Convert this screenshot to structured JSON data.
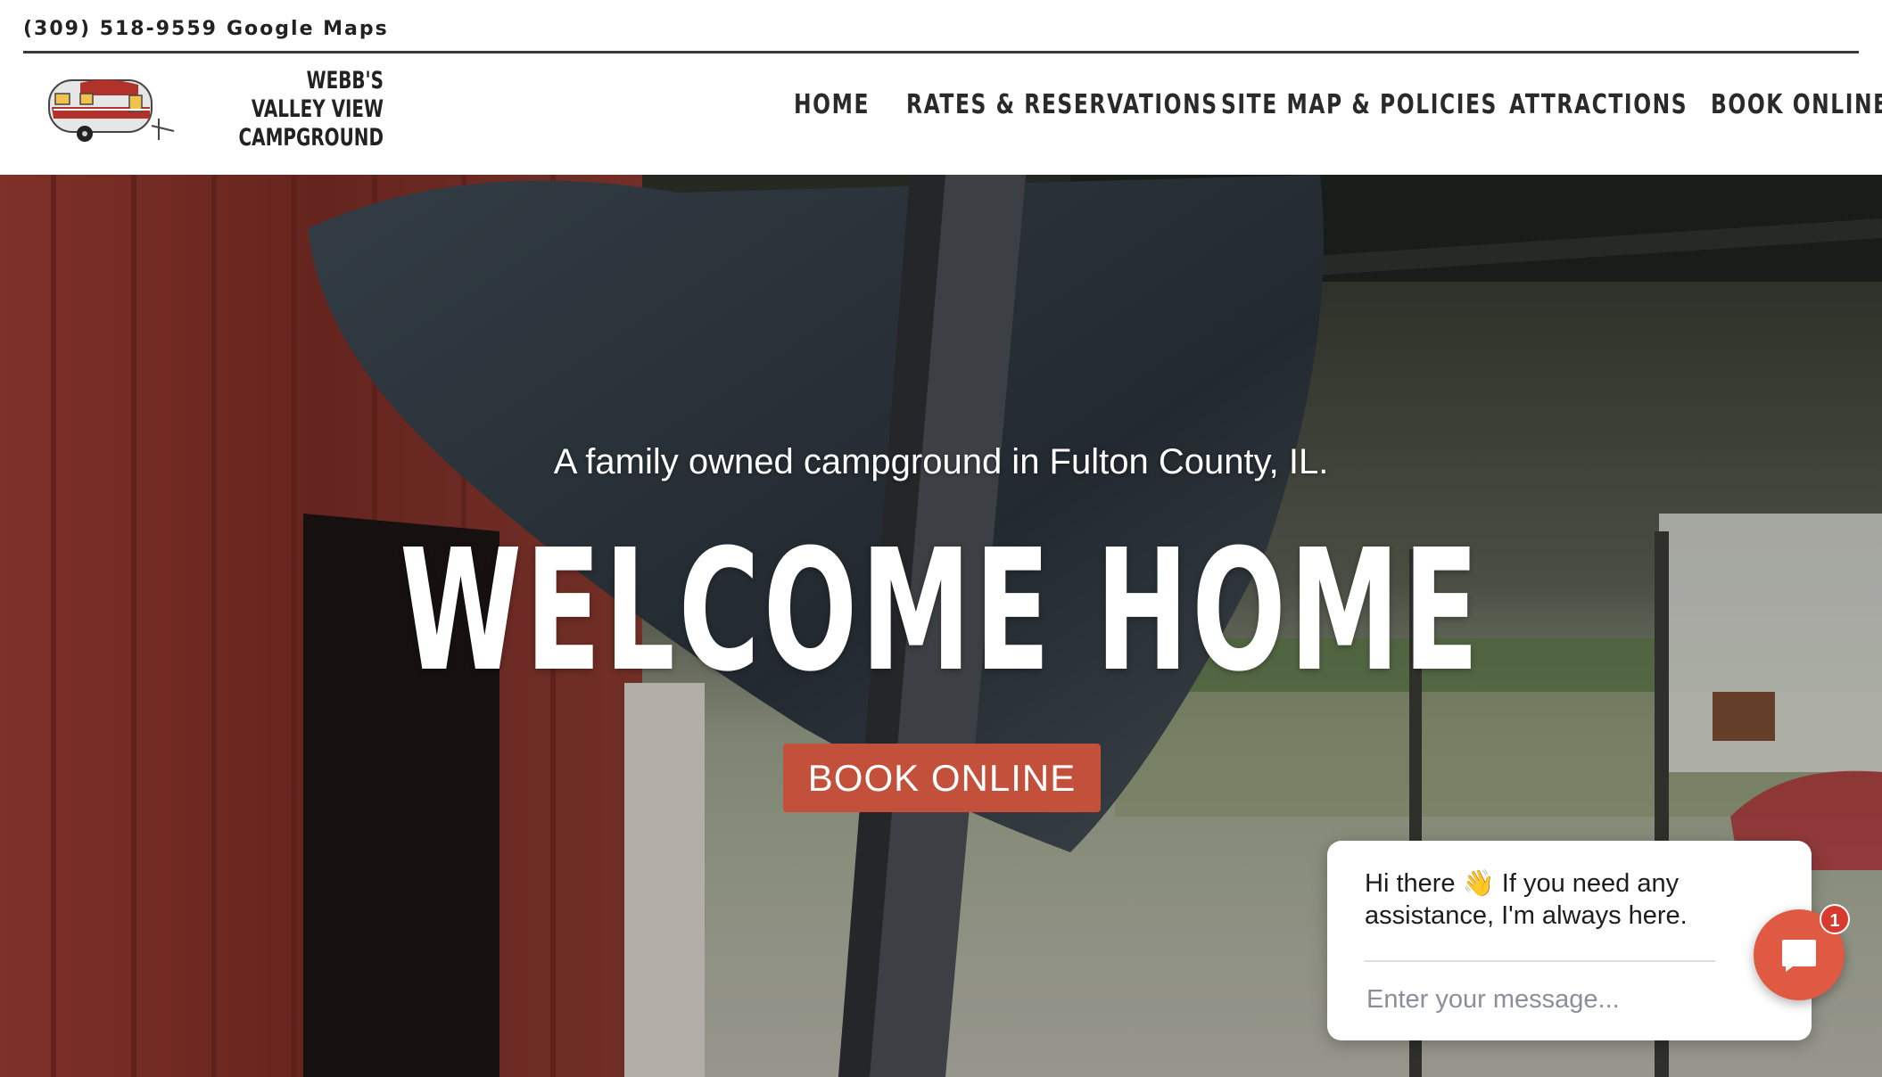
{
  "topbar": {
    "phone": "(309) 518-9559",
    "maps_link": "Google Maps"
  },
  "brand": {
    "line1": "WEBB'S",
    "line2": "VALLEY VIEW",
    "line3": "CAMPGROUND",
    "logo_icon": "camper-trailer-icon"
  },
  "nav": {
    "items": [
      "HOME",
      "RATES & RESERVATIONS",
      "SITE MAP & POLICIES",
      "ATTRACTIONS",
      "BOOK ONLINE"
    ]
  },
  "hero": {
    "tagline": "A family owned campground in Fulton County, IL.",
    "headline": "WELCOME HOME",
    "cta_label": "BOOK ONLINE",
    "cta_color": "#c2503a"
  },
  "chat": {
    "message_prefix": "Hi there",
    "message_emoji": "👋",
    "message_suffix": "If you need any assistance, I'm always here.",
    "input_placeholder": "Enter your message...",
    "unread_count": "1",
    "button_icon": "chat-bubble-icon",
    "accent": "#e05a43"
  }
}
